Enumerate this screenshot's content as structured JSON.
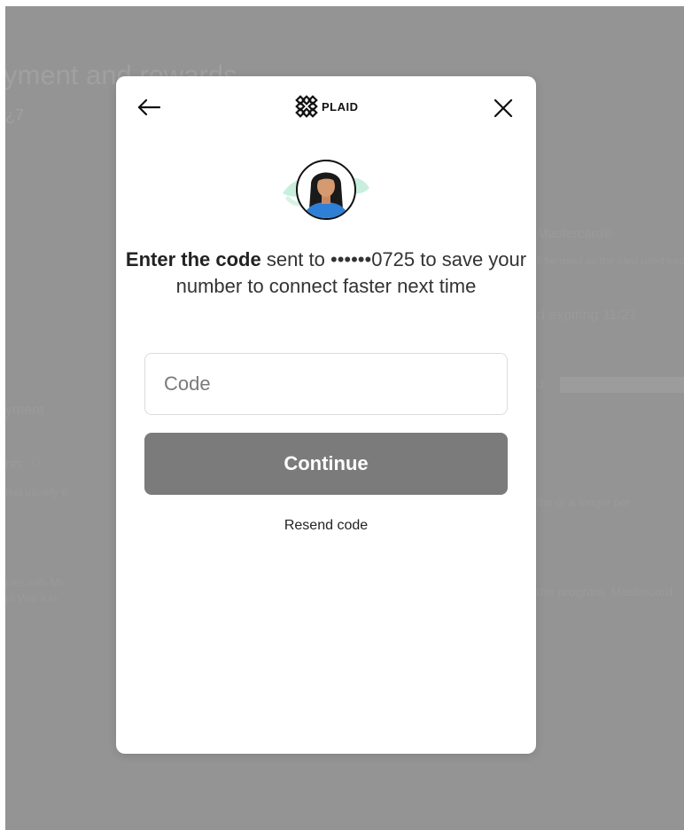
{
  "background": {
    "heading": "yment and rewards",
    "subheading": "¿7",
    "right_col": [
      "Mastercard®",
      "ll be used as the card used each mon",
      "d expiring 11/27",
      "d",
      "ths or a longer per",
      "the program. Mastercard"
    ],
    "left_col": [
      "yment",
      "nts ⓘ",
      "rsal usually b",
      "ntes with Mo",
      "to Visit a lo"
    ]
  },
  "modal": {
    "logo_text": "PLAID",
    "headline_strong": "Enter the code",
    "headline_rest": " sent to ••••••0725 to save your number to connect faster next time",
    "code_placeholder": "Code",
    "continue_label": "Continue",
    "resend_label": "Resend code"
  },
  "colors": {
    "overlay": "#949494",
    "button": "#7b7b7b",
    "avatar_blue": "#2f7fd6",
    "accent_mint": "#bfe9d9"
  },
  "icons": {
    "back": "arrow-left-icon",
    "close": "close-icon",
    "logo": "plaid-logo-icon",
    "avatar": "user-avatar"
  }
}
